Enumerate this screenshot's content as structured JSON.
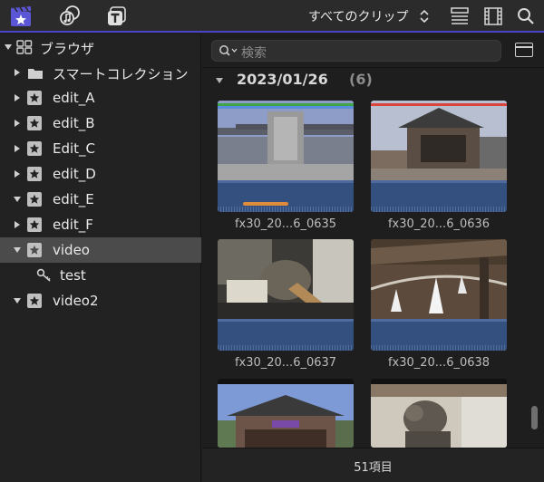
{
  "toolbar": {
    "filter_label": "すべてのクリップ",
    "icons": [
      "libraries-icon",
      "photos-audio-icon",
      "titles-generators-icon",
      "filter-updown-icon",
      "list-view-icon",
      "filmstrip-icon",
      "search-icon"
    ],
    "accent": "#4a44c9"
  },
  "sidebar": {
    "items": [
      {
        "label": "ブラウザ",
        "icon": "grid-icon",
        "expanded": true
      },
      {
        "label": "スマートコレクション",
        "icon": "folder-icon",
        "expanded": false
      },
      {
        "label": "edit_A",
        "icon": "event-star-icon",
        "expanded": false
      },
      {
        "label": "edit_B",
        "icon": "event-star-icon",
        "expanded": false
      },
      {
        "label": "Edit_C",
        "icon": "event-star-icon",
        "expanded": false
      },
      {
        "label": "edit_D",
        "icon": "event-star-icon",
        "expanded": false
      },
      {
        "label": "edit_E",
        "icon": "event-star-icon",
        "expanded": true
      },
      {
        "label": "edit_F",
        "icon": "event-star-icon",
        "expanded": false
      },
      {
        "label": "video",
        "icon": "event-star-icon",
        "expanded": true,
        "selected": true
      },
      {
        "label": "test",
        "icon": "keyword-icon"
      },
      {
        "label": "video2",
        "icon": "event-star-icon",
        "expanded": true
      }
    ],
    "selected_color": "#4b4b4b"
  },
  "browser": {
    "search_placeholder": "検索",
    "group": {
      "date": "2023/01/26",
      "count": "(6)"
    },
    "clips": [
      {
        "name": "fx30_20...6_0635"
      },
      {
        "name": "fx30_20...6_0636"
      },
      {
        "name": "fx30_20...6_0637"
      },
      {
        "name": "fx30_20...6_0638"
      },
      {
        "name": ""
      },
      {
        "name": ""
      }
    ],
    "status": "51項目"
  }
}
